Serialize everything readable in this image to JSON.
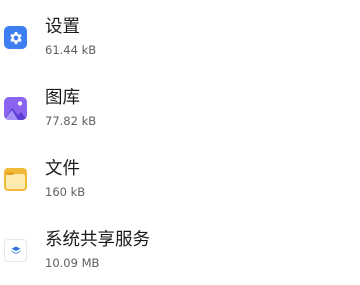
{
  "apps": [
    {
      "name": "设置",
      "size": "61.44 kB",
      "icon": "gear-icon",
      "color": "#3d7ff0"
    },
    {
      "name": "图库",
      "size": "77.82 kB",
      "icon": "gallery-icon",
      "color": "#8a63ee"
    },
    {
      "name": "文件",
      "size": "160 kB",
      "icon": "folder-icon",
      "color": "#f0b93a"
    },
    {
      "name": "系统共享服务",
      "size": "10.09 MB",
      "icon": "share-service-icon",
      "color": "#2f6fe0"
    }
  ]
}
